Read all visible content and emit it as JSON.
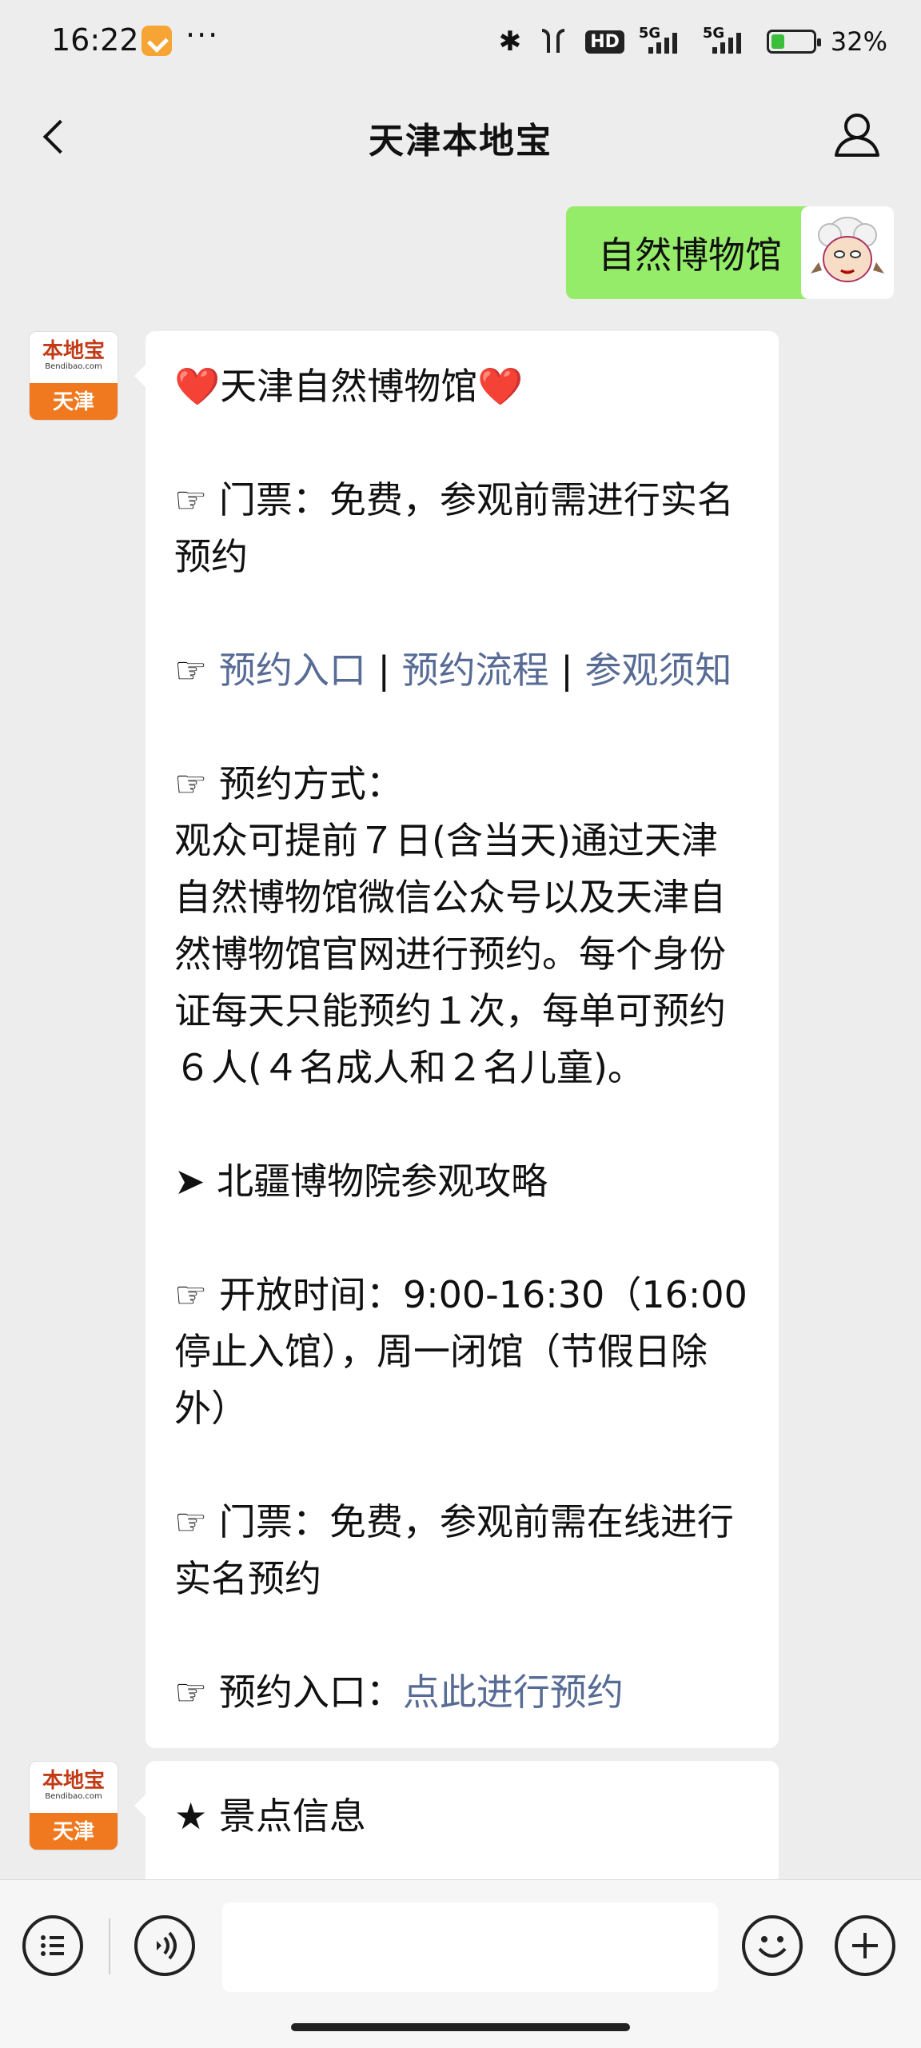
{
  "status": {
    "time": "16:22",
    "more": "···",
    "hd": "HD",
    "net1": "5G",
    "net2": "5G",
    "battery_percent": "32%",
    "battery_level": 0.32
  },
  "nav": {
    "title": "天津本地宝"
  },
  "my_message": {
    "text": "自然博物馆"
  },
  "bot": {
    "avatar_logo": "本地宝",
    "avatar_sub": "Bendibao.com",
    "avatar_city": "天津"
  },
  "message1": {
    "title_prefix": "❤️",
    "title": "天津自然博物馆",
    "title_suffix": "❤️",
    "ticket1": "☞ 门票：免费，参观前需进行实名预约",
    "links_prefix": "☞ ",
    "link1": "预约入口",
    "sep1": " | ",
    "link2": "预约流程",
    "sep2": " | ",
    "link3": "参观须知",
    "method_title": "☞ 预约方式：",
    "method_text": "观众可提前７日(含当天)通过天津自然博物馆微信公众号以及天津自然博物馆官网进行预约。每个身份证每天只能预约１次，每单可预约６人(４名成人和２名儿童)。",
    "guide": "➤ 北疆博物院参观攻略",
    "hours": "☞ 开放时间：9:00-16:30（16:00停止入馆），周一闭馆（节假日除外）",
    "ticket2": "☞ 门票：免费，参观前需在线进行实名预约",
    "booking_prefix": "☞ 预约入口：",
    "booking_link": "点此进行预约"
  },
  "message2": {
    "text": "★ 景点信息"
  },
  "input": {
    "placeholder": ""
  }
}
